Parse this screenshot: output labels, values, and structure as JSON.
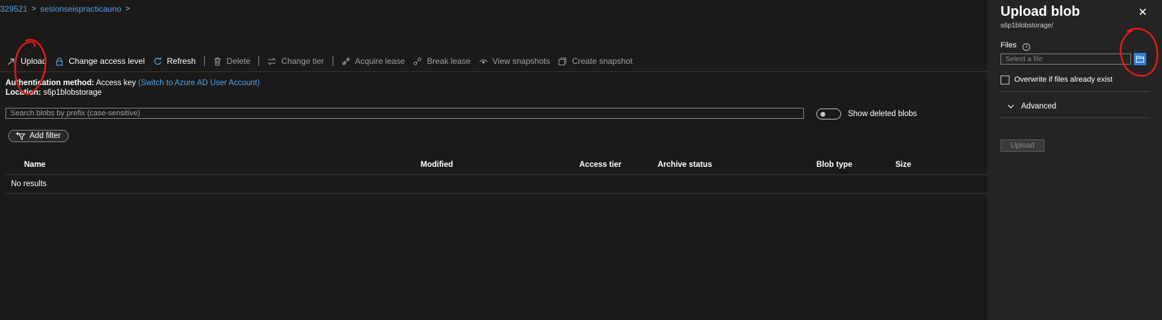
{
  "breadcrumb": {
    "items": [
      "329521",
      "sesionseispracticauno"
    ]
  },
  "toolbar": {
    "items": [
      {
        "label": "Upload",
        "icon": "upload-icon",
        "disabled": false
      },
      {
        "label": "Change access level",
        "icon": "lock-icon",
        "disabled": false
      },
      {
        "label": "Refresh",
        "icon": "refresh-icon",
        "disabled": false
      },
      {
        "label": "Delete",
        "icon": "trash-icon",
        "disabled": true
      },
      {
        "label": "Change tier",
        "icon": "swap-icon",
        "disabled": true
      },
      {
        "label": "Acquire lease",
        "icon": "link-icon",
        "disabled": true
      },
      {
        "label": "Break lease",
        "icon": "broken-link-icon",
        "disabled": true
      },
      {
        "label": "View snapshots",
        "icon": "eye-icon",
        "disabled": true
      },
      {
        "label": "Create snapshot",
        "icon": "snapshot-icon",
        "disabled": true
      }
    ]
  },
  "info": {
    "auth_label": "Authentication method:",
    "auth_value": "Access key",
    "auth_link": "(Switch to Azure AD User Account)",
    "location_label": "Location:",
    "location_value": "s6p1blobstorage"
  },
  "search": {
    "placeholder": "Search blobs by prefix (case-sensitive)"
  },
  "show_deleted": {
    "label": "Show deleted blobs",
    "on": false
  },
  "add_filter": {
    "label": "Add filter"
  },
  "table": {
    "columns": [
      "Name",
      "Modified",
      "Access tier",
      "Archive status",
      "Blob type",
      "Size"
    ],
    "empty_text": "No results"
  },
  "panel": {
    "title": "Upload blob",
    "subtitle": "s6p1blobstorage/",
    "files_label": "Files",
    "file_placeholder": "Select a file",
    "overwrite_label": "Overwrite if files already exist",
    "advanced_label": "Advanced",
    "upload_label": "Upload"
  },
  "colors": {
    "background": "#1b1a19",
    "panel": "#252423",
    "link": "#4ea1e8",
    "accent": "#2f7ed3",
    "annotation": "#e01b1b"
  }
}
